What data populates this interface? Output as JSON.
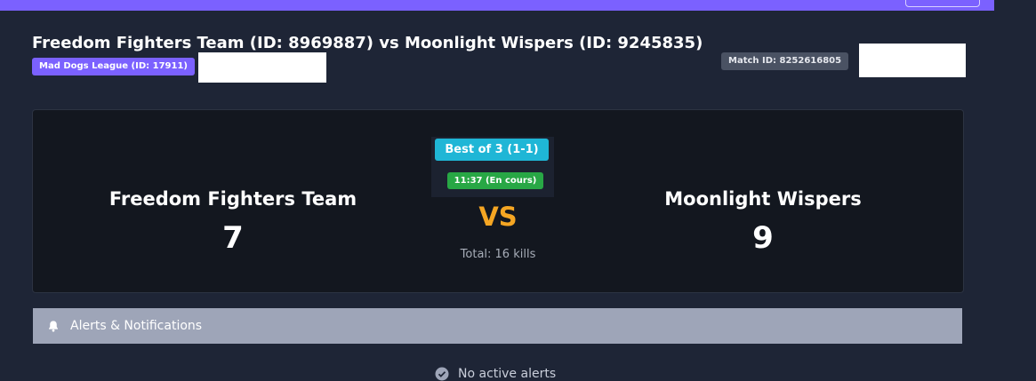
{
  "match": {
    "title": "Freedom Fighters Team (ID: 8969887) vs Moonlight Wispers (ID: 9245835)",
    "league_badge": "Mad Dogs League (ID: 17911)",
    "match_id_badge": "Match ID: 8252616805"
  },
  "scoreboard": {
    "home_team": "Freedom Fighters Team",
    "home_score": "7",
    "away_team": "Moonlight Wispers",
    "away_score": "9",
    "best_of": "Best of 3 (1-1)",
    "time_status": "11:37 (En cours)",
    "vs_label": "VS",
    "total_kills": "Total: 16 kills"
  },
  "alerts": {
    "title": "Alerts & Notifications",
    "empty_message": "No active alerts"
  },
  "colors": {
    "accent": "#7b61ff",
    "background": "#1e2536",
    "card": "#13171f",
    "best_of_badge": "#1fb6d6",
    "live_badge": "#28a745",
    "vs": "#f5a623",
    "alerts_header": "#9ea5b8"
  },
  "icons": {
    "alerts_header_icon": "bell-icon",
    "empty_state_icon": "check-circle-icon"
  }
}
